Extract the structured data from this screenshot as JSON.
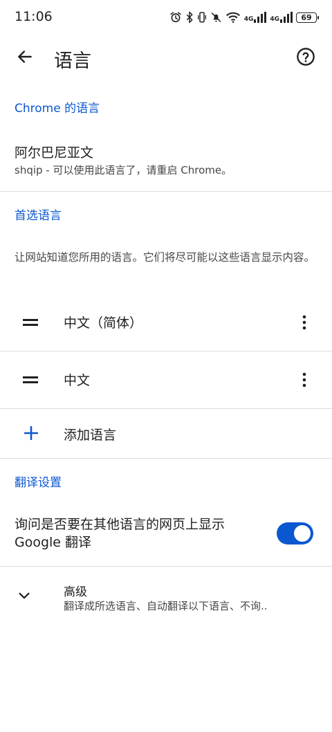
{
  "status_bar": {
    "time": "11:06",
    "network_1": "4G",
    "network_2": "4G",
    "battery": "69",
    "icons": [
      "alarm-icon",
      "bluetooth-icon",
      "vibrate-icon",
      "mute-icon",
      "wifi-icon",
      "signal-icon",
      "signal-icon",
      "battery-icon"
    ]
  },
  "app_bar": {
    "title": "语言",
    "back_icon": "arrow-back-icon",
    "help_icon": "help-icon"
  },
  "chrome_language": {
    "header": "Chrome 的语言",
    "current_language": "阿尔巴尼亚文",
    "current_language_sub": "shqip - 可以使用此语言了，请重启 Chrome。"
  },
  "preferred_languages": {
    "header": "首选语言",
    "description": "让网站知道您所用的语言。它们将尽可能以这些语言显示内容。",
    "items": [
      {
        "name": "中文（简体）"
      },
      {
        "name": "中文"
      }
    ],
    "add_label": "添加语言"
  },
  "translate_settings": {
    "header": "翻译设置",
    "offer_translate_label": "询问是否要在其他语言的网页上显示 Google 翻译",
    "offer_translate_enabled": true,
    "advanced_title": "高级",
    "advanced_sub": "翻译成所选语言、自动翻译以下语言、不询.."
  },
  "colors": {
    "accent": "#0b57d0",
    "text_primary": "#1f1f1f",
    "text_secondary": "#444746",
    "divider": "#dadce0"
  }
}
